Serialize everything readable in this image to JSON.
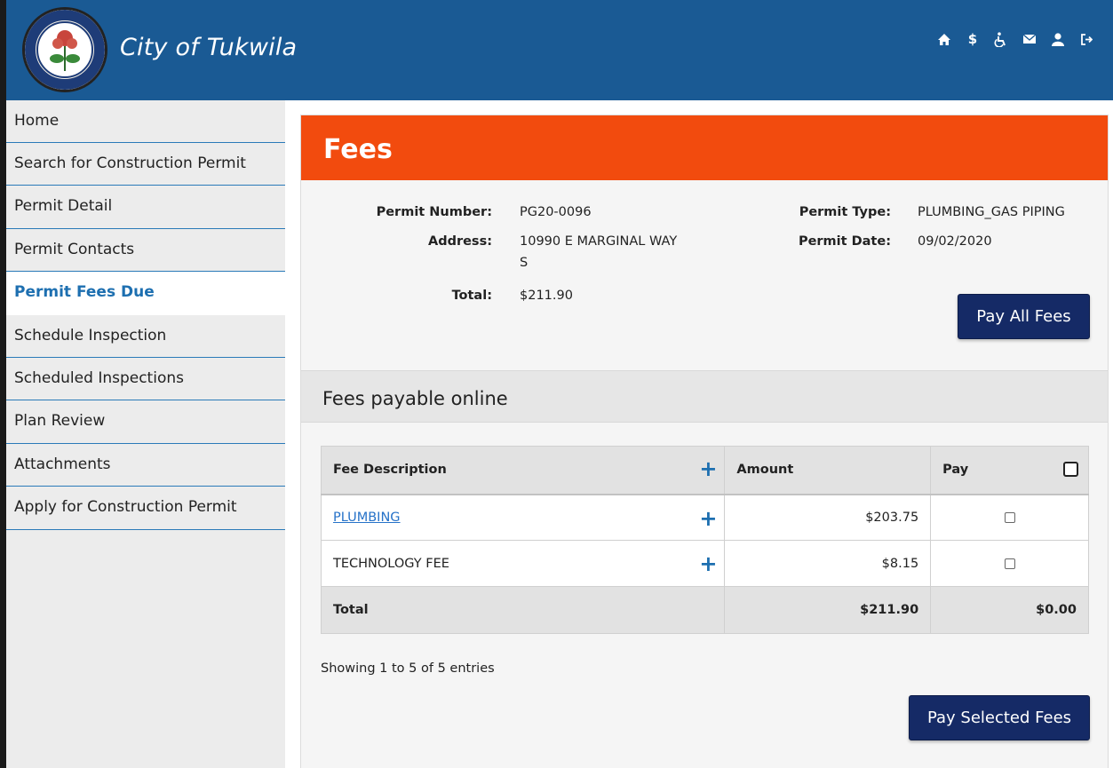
{
  "header": {
    "brand": "City of Tukwila",
    "icons": [
      "home-icon",
      "dollar-icon",
      "accessibility-icon",
      "mail-icon",
      "user-icon",
      "logout-icon"
    ]
  },
  "sidebar": {
    "items": [
      {
        "label": "Home"
      },
      {
        "label": "Search for Construction Permit"
      },
      {
        "label": "Permit Detail"
      },
      {
        "label": "Permit Contacts"
      },
      {
        "label": "Permit Fees Due",
        "active": true
      },
      {
        "label": "Schedule Inspection"
      },
      {
        "label": "Scheduled Inspections"
      },
      {
        "label": "Plan Review"
      },
      {
        "label": "Attachments"
      },
      {
        "label": "Apply for Construction Permit"
      }
    ]
  },
  "panel": {
    "title": "Fees",
    "info": {
      "permit_number_label": "Permit Number:",
      "permit_number": "PG20-0096",
      "address_label": "Address:",
      "address_line1": "10990 E MARGINAL WAY",
      "address_line2": "S",
      "total_label": "Total:",
      "total": "$211.90",
      "permit_type_label": "Permit Type:",
      "permit_type": "PLUMBING_GAS PIPING",
      "permit_date_label": "Permit Date:",
      "permit_date": "09/02/2020"
    },
    "pay_all_label": "Pay All Fees",
    "section_title": "Fees payable online",
    "table": {
      "columns": [
        "Fee Description",
        "Amount",
        "Pay"
      ],
      "rows": [
        {
          "description": "PLUMBING",
          "amount": "$203.75",
          "link": true
        },
        {
          "description": "TECHNOLOGY FEE",
          "amount": "$8.15",
          "link": false
        }
      ],
      "footer": {
        "label": "Total",
        "amount": "$211.90",
        "pay_total": "$0.00"
      }
    },
    "showing": "Showing 1 to 5 of 5 entries",
    "pay_selected_label": "Pay Selected Fees"
  },
  "colors": {
    "header_blue": "#1a5a94",
    "title_orange": "#f24b0e",
    "button_navy": "#152a66",
    "link_blue": "#2672c8"
  }
}
